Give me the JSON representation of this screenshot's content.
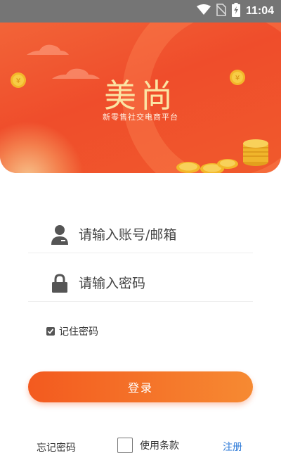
{
  "status_bar": {
    "time": "11:04",
    "icons": [
      "wifi-icon",
      "no-sim-icon",
      "battery-charging-icon"
    ]
  },
  "banner": {
    "title": "美尚",
    "subtitle": "新零售社交电商平台"
  },
  "form": {
    "account_placeholder": "请输入账号/邮箱",
    "password_placeholder": "请输入密码",
    "remember_label": "记住密码",
    "remember_checked": true,
    "login_label": "登录"
  },
  "footer": {
    "forgot_label": "忘记密码",
    "terms_label": "使用条款",
    "terms_checked": false,
    "register_label": "注册"
  },
  "colors": {
    "banner": "#ef4d2b",
    "button_start": "#f35a1f",
    "button_end": "#f68a32",
    "link": "#2f7bd8",
    "title_gold": "#fbe4a4"
  }
}
